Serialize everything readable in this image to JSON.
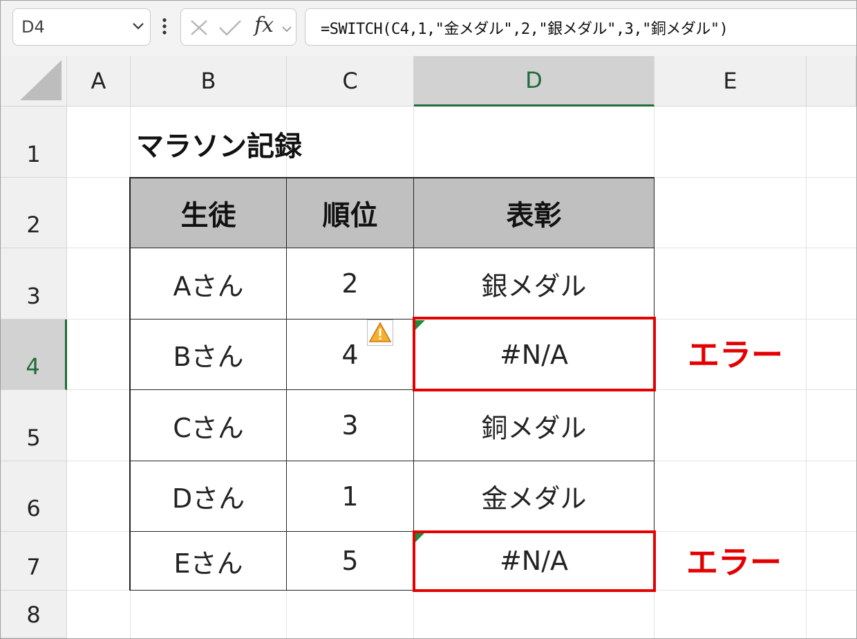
{
  "formula_bar": {
    "name_box": "D4",
    "fx_label": "fx",
    "formula": "=SWITCH(C4,1,\"金メダル\",2,\"銀メダル\",3,\"銅メダル\")"
  },
  "columns": [
    "A",
    "B",
    "C",
    "D",
    "E"
  ],
  "rows": [
    "1",
    "2",
    "3",
    "4",
    "5",
    "6",
    "7",
    "8"
  ],
  "sheet": {
    "title": "マラソン記録",
    "headers": [
      "生徒",
      "順位",
      "表彰"
    ],
    "records": [
      {
        "student": "Aさん",
        "rank": "2",
        "award": "銀メダル"
      },
      {
        "student": "Bさん",
        "rank": "4",
        "award": "#N/A"
      },
      {
        "student": "Cさん",
        "rank": "3",
        "award": "銅メダル"
      },
      {
        "student": "Dさん",
        "rank": "1",
        "award": "金メダル"
      },
      {
        "student": "Eさん",
        "rank": "5",
        "award": "#N/A"
      }
    ]
  },
  "annotations": {
    "error_label_1": "エラー",
    "error_label_2": "エラー"
  },
  "colors": {
    "accent_green": "#1e6b3a",
    "error_red": "#e50000",
    "header_fill": "#c0c0c0"
  },
  "icons": {
    "warning": "warning-triangle-icon",
    "cancel": "x-icon",
    "enter": "check-icon"
  }
}
